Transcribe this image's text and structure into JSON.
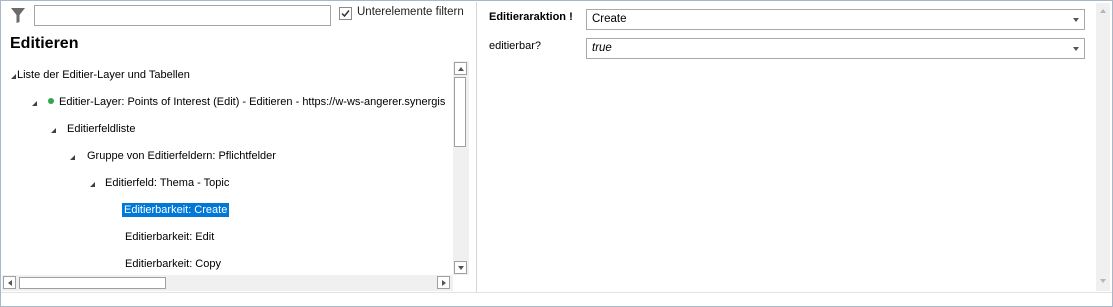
{
  "filter": {
    "value": "",
    "checkbox_label": "Unterelemente filtern",
    "checkbox_checked": true
  },
  "panel_title": "Editieren",
  "tree": [
    {
      "label": "Liste der Editier-Layer und Tabellen",
      "expanded": true,
      "status_dot": false,
      "selected": false
    },
    {
      "label": "Editier-Layer: Points of Interest (Edit) - Editieren - https://w-ws-angerer.synergis",
      "expanded": true,
      "status_dot": true,
      "selected": false
    },
    {
      "label": "Editierfeldliste",
      "expanded": true,
      "status_dot": false,
      "selected": false
    },
    {
      "label": "Gruppe von Editierfeldern: Pflichtfelder",
      "expanded": true,
      "status_dot": false,
      "selected": false
    },
    {
      "label": "Editierfeld: Thema - Topic",
      "expanded": true,
      "status_dot": false,
      "selected": false
    },
    {
      "label": "Editierbarkeit: Create",
      "expanded": false,
      "status_dot": false,
      "selected": true
    },
    {
      "label": "Editierbarkeit: Edit",
      "expanded": false,
      "status_dot": false,
      "selected": false
    },
    {
      "label": "Editierbarkeit: Copy",
      "expanded": false,
      "status_dot": false,
      "selected": false
    }
  ],
  "properties": {
    "edit_action": {
      "label": "Editieraraktion !",
      "value": "Create"
    },
    "editable": {
      "label": "editierbar?",
      "value": "true"
    }
  },
  "colors": {
    "selection": "#0078d7",
    "status_dot": "#2fa84f"
  }
}
